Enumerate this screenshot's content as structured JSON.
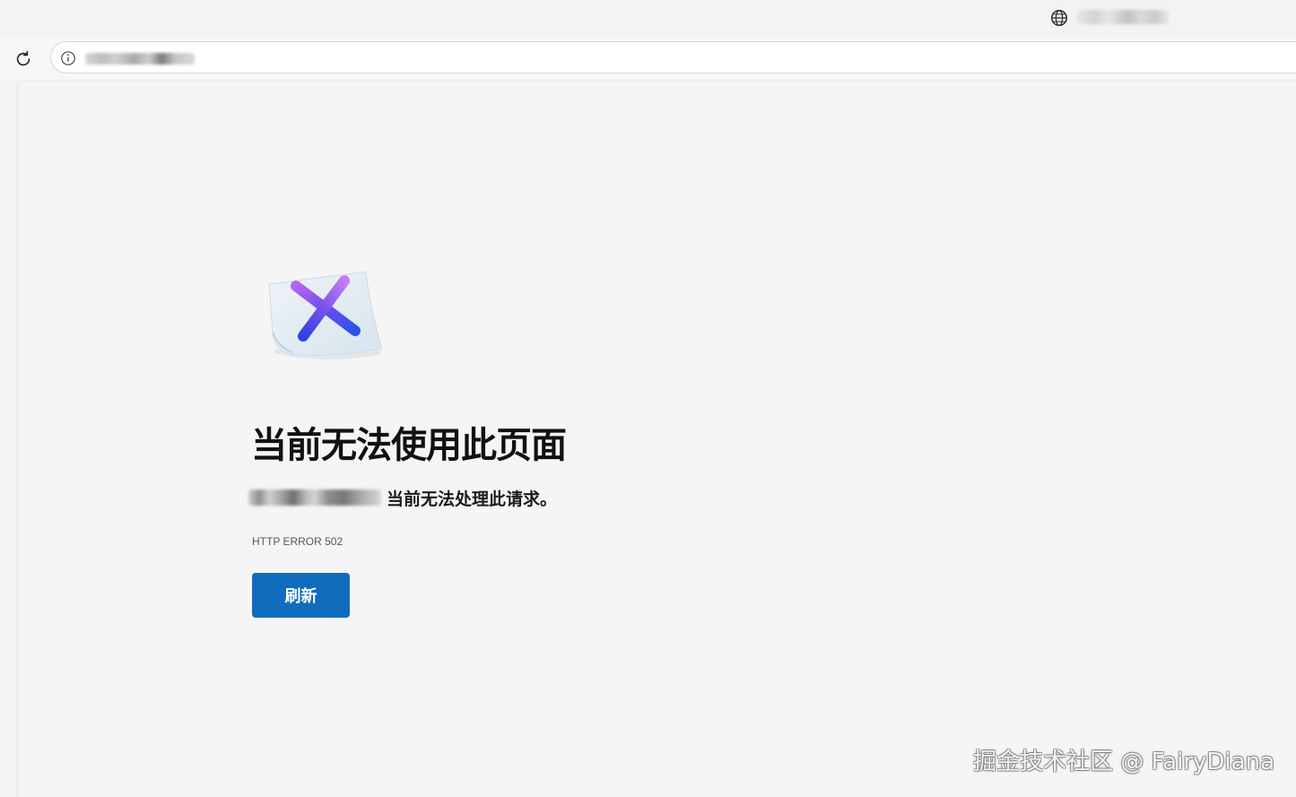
{
  "browser": {
    "tab": {
      "icon": "globe-icon",
      "title": ""
    },
    "toolbar": {
      "reload_icon": "reload-icon",
      "site_info_icon": "info-icon",
      "url": ""
    }
  },
  "error_page": {
    "illustration": "error-x-illustration",
    "heading": "当前无法使用此页面",
    "host": "",
    "message": "当前无法处理此请求。",
    "code": "HTTP ERROR 502",
    "refresh_label": "刷新"
  },
  "watermark": "掘金技术社区 @ FairyDiana",
  "colors": {
    "button": "#0f6cbd",
    "x_gradient_start": "#a855f7",
    "x_gradient_end": "#2f4fe0"
  }
}
